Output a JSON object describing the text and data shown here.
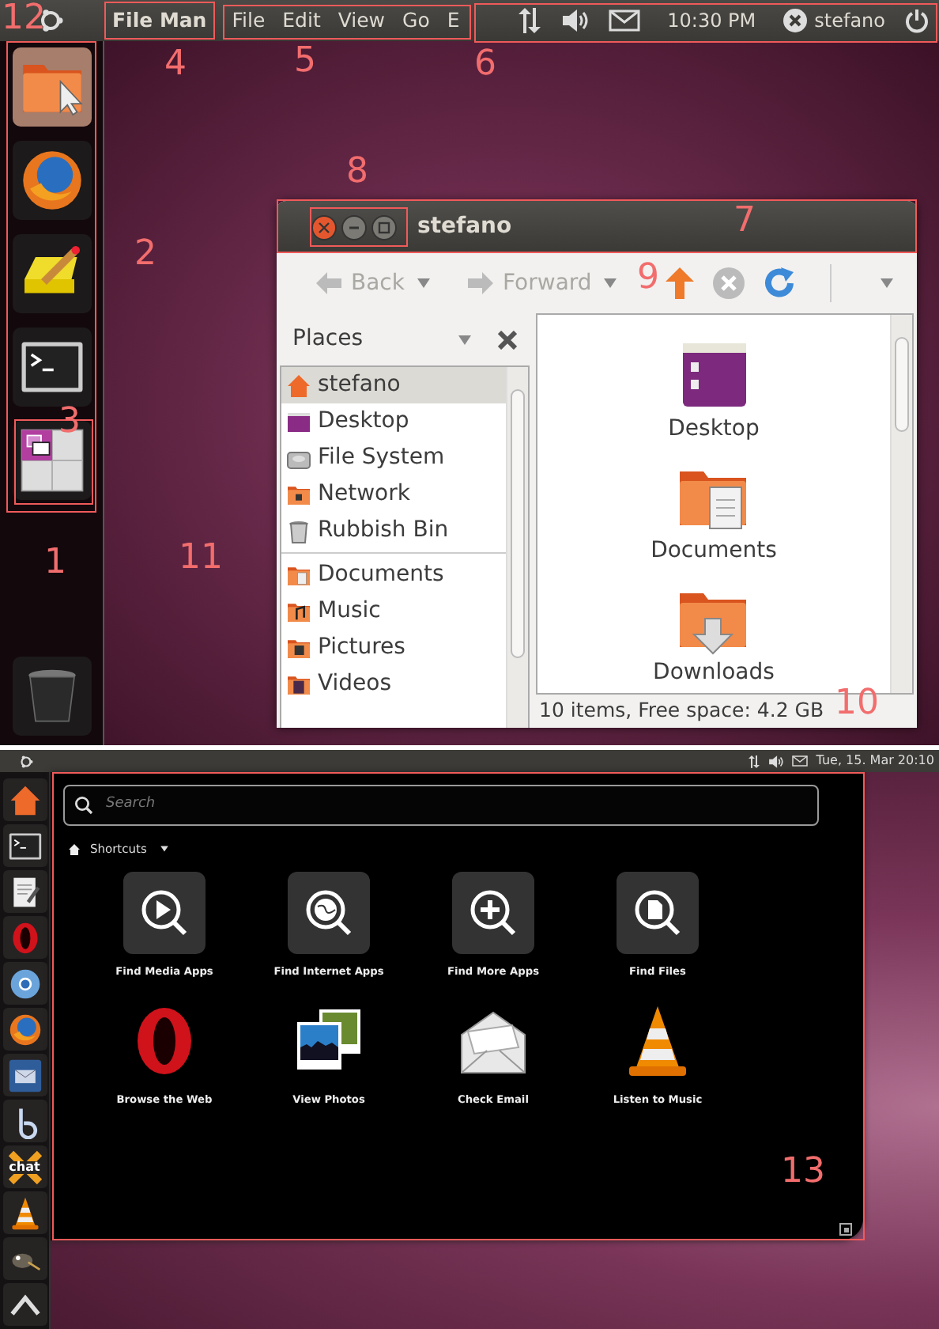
{
  "top_screenshot": {
    "panel": {
      "app_title": "File Man",
      "menus": [
        "File",
        "Edit",
        "View",
        "Go",
        "E"
      ],
      "clock": "10:30 PM",
      "user": "stefano"
    },
    "launcher": {
      "items": [
        {
          "kind": "folder",
          "selected": true
        },
        {
          "kind": "browser",
          "selected": false
        },
        {
          "kind": "notepad",
          "selected": false
        },
        {
          "kind": "terminal",
          "selected": false
        },
        {
          "kind": "workspaces",
          "selected": false
        }
      ],
      "trash": {
        "kind": "trash"
      }
    },
    "window": {
      "title": "stefano",
      "toolbar": [
        {
          "kind": "back",
          "label": "Back",
          "disabled": true
        },
        {
          "kind": "forward",
          "label": "Forward",
          "disabled": true
        },
        {
          "kind": "up",
          "disabled": false
        },
        {
          "kind": "stop",
          "disabled": true
        },
        {
          "kind": "reload",
          "disabled": false
        }
      ],
      "sidebar": {
        "title": "Places",
        "sections": [
          [
            {
              "label": "stefano",
              "kind": "home",
              "selected": true
            },
            {
              "label": "Desktop",
              "kind": "desktop",
              "selected": false
            },
            {
              "label": "File System",
              "kind": "drive",
              "selected": false
            },
            {
              "label": "Network",
              "kind": "network",
              "selected": false
            },
            {
              "label": "Rubbish Bin",
              "kind": "trash",
              "selected": false
            }
          ],
          [
            {
              "label": "Documents",
              "kind": "documents",
              "selected": false
            },
            {
              "label": "Music",
              "kind": "music",
              "selected": false
            },
            {
              "label": "Pictures",
              "kind": "pictures",
              "selected": false
            },
            {
              "label": "Videos",
              "kind": "videos",
              "selected": false
            }
          ]
        ]
      },
      "files": [
        {
          "label": "Desktop",
          "kind": "desktop"
        },
        {
          "label": "Documents",
          "kind": "documents"
        },
        {
          "label": "Downloads",
          "kind": "downloads"
        }
      ],
      "status": "10 items, Free space: 4.2 GB"
    }
  },
  "bottom_screenshot": {
    "panel": {
      "clock": "Tue, 15. Mar 20:10"
    },
    "launcher": {
      "items": [
        {
          "kind": "home"
        },
        {
          "kind": "terminal"
        },
        {
          "kind": "editor"
        },
        {
          "kind": "opera"
        },
        {
          "kind": "chromium"
        },
        {
          "kind": "browser"
        },
        {
          "kind": "mail"
        },
        {
          "kind": "b"
        },
        {
          "kind": "xchat",
          "text": "chat"
        },
        {
          "kind": "vlc"
        },
        {
          "kind": "gimp"
        },
        {
          "kind": "arrow"
        }
      ]
    },
    "dash": {
      "search": {
        "placeholder": "Search"
      },
      "filter": "Shortcuts",
      "shortcuts": [
        {
          "label": "Find Media Apps",
          "kind": "lens-media"
        },
        {
          "label": "Find Internet Apps",
          "kind": "lens-internet"
        },
        {
          "label": "Find More Apps",
          "kind": "lens-more"
        },
        {
          "label": "Find Files",
          "kind": "lens-files"
        },
        {
          "label": "Browse the Web",
          "kind": "opera"
        },
        {
          "label": "View Photos",
          "kind": "photos"
        },
        {
          "label": "Check Email",
          "kind": "email"
        },
        {
          "label": "Listen to Music",
          "kind": "vlc"
        }
      ]
    }
  },
  "annotations": [
    {
      "label": "12"
    },
    {
      "label": "4"
    },
    {
      "label": "5"
    },
    {
      "label": "6"
    },
    {
      "label": "8"
    },
    {
      "label": "7"
    },
    {
      "label": "2"
    },
    {
      "label": "9"
    },
    {
      "label": "3"
    },
    {
      "label": "11"
    },
    {
      "label": "1"
    },
    {
      "label": "10"
    },
    {
      "label": "13"
    }
  ]
}
